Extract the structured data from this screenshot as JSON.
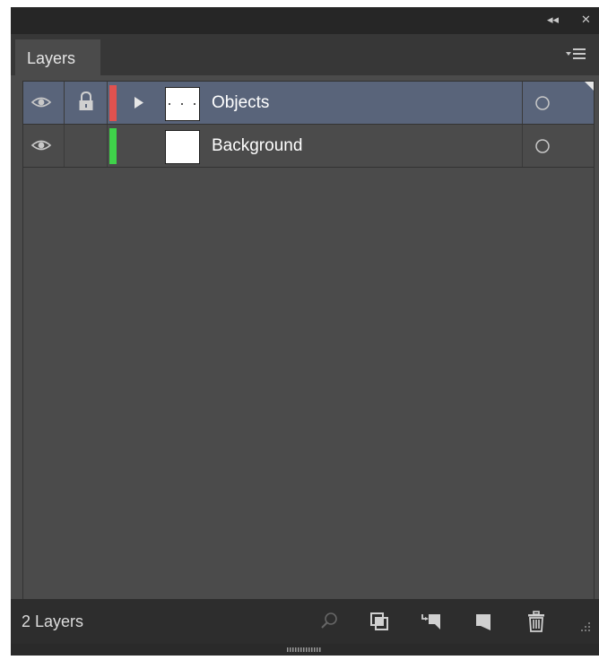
{
  "panel": {
    "title_bar": {
      "collapse_glyph": "◂◂",
      "close_glyph": "✕"
    },
    "tab": {
      "label": "Layers"
    },
    "layers": [
      {
        "name": "Objects",
        "visible": true,
        "locked": true,
        "color": "#e0524f",
        "expandable": true,
        "selected": true
      },
      {
        "name": "Background",
        "visible": true,
        "locked": false,
        "color": "#3fd24a",
        "expandable": false,
        "selected": false
      }
    ],
    "footer": {
      "count_label": "2 Layers"
    }
  }
}
